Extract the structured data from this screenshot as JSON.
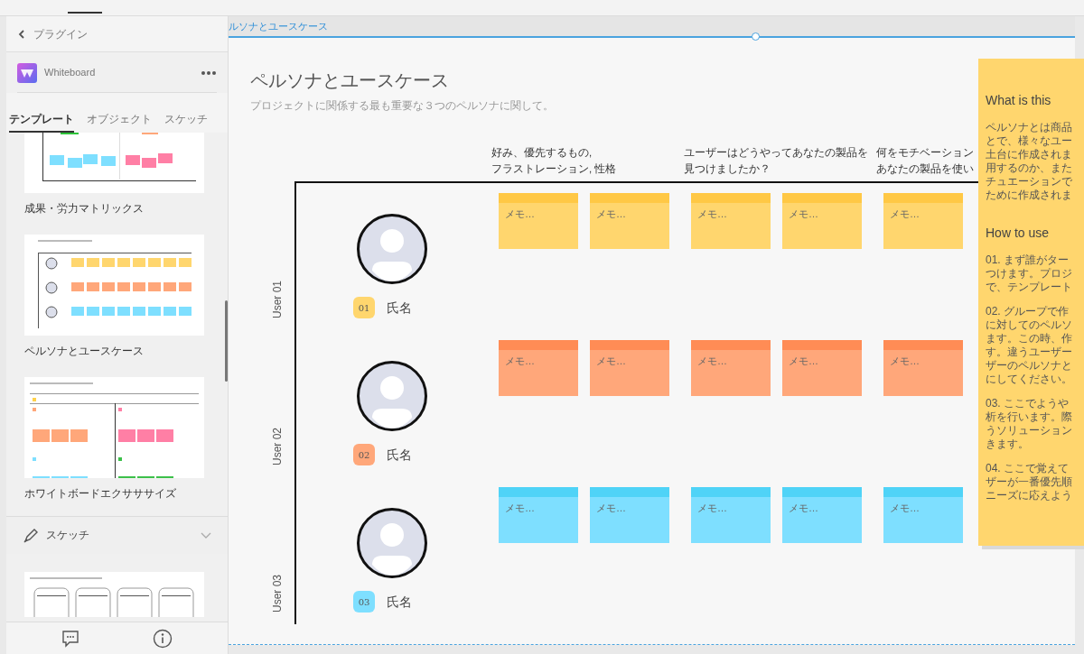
{
  "sidebar": {
    "back_label": "プラグイン",
    "plugin_name": "Whiteboard",
    "tabs": [
      {
        "label": "テンプレート",
        "selected": true
      },
      {
        "label": "オブジェクト",
        "selected": false
      },
      {
        "label": "スケッチ",
        "selected": false
      }
    ],
    "templates": [
      {
        "kind": "matrix",
        "label": "成果・労力マトリックス"
      },
      {
        "kind": "persona",
        "label": "ペルソナとユースケース"
      },
      {
        "kind": "exercise",
        "label": "ホワイトボードエクサササイズ"
      }
    ],
    "section": {
      "label": "スケッチ"
    },
    "section_templates": [
      {
        "kind": "sketch"
      }
    ]
  },
  "artboard_label": "ルソナとユースケース",
  "board": {
    "title": "ペルソナとユースケース",
    "subtitle": "プロジェクトに関係する最も重要な３つのペルソナに関して。",
    "columns": [
      [
        "好み、優先するもの,",
        "フラストレーション, 性格"
      ],
      [
        "ユーザーはどうやってあなたの製品を",
        "見つけましたか？"
      ],
      [
        "何をモチベーション",
        "あなたの製品を使い"
      ]
    ],
    "rows": [
      {
        "label": "User 01",
        "badge": "01",
        "name": "氏名",
        "color": "#ffd66e",
        "notes": [
          [
            "メモ…",
            "メモ…"
          ],
          [
            "メモ…",
            "メモ…"
          ],
          [
            "メモ…"
          ]
        ]
      },
      {
        "label": "User 02",
        "badge": "02",
        "name": "氏名",
        "color": "#ffa77a",
        "notes": [
          [
            "メモ…",
            "メモ…"
          ],
          [
            "メモ…",
            "メモ…"
          ],
          [
            "メモ…"
          ]
        ]
      },
      {
        "label": "User 03",
        "badge": "03",
        "name": "氏名",
        "color": "#7edfff",
        "notes": [
          [
            "メモ…",
            "メモ…"
          ],
          [
            "メモ…",
            "メモ…"
          ],
          [
            "メモ…"
          ]
        ]
      }
    ]
  },
  "info_panel": {
    "heading": "What is this",
    "intro": [
      "ペルソナとは商品",
      "とで、様々なユー",
      "土台に作成されま",
      "用するのか、また",
      "チュエーションで",
      "ために作成されま"
    ],
    "how_heading": "How to use",
    "steps": [
      [
        "01. まず誰がター",
        "つけます。プロジ",
        "で、テンプレート"
      ],
      [
        "02. グループで作",
        "に対してのペルソ",
        "ます。この時、作",
        "す。違うユーザー",
        "ザーのペルソナと",
        "にしてください。"
      ],
      [
        "03. ここでようや",
        "析を行います。際",
        "うソリューション",
        "きます。"
      ],
      [
        "04. ここで覚えて",
        "ザーが一番優先順",
        "ニーズに応えよう"
      ]
    ]
  }
}
